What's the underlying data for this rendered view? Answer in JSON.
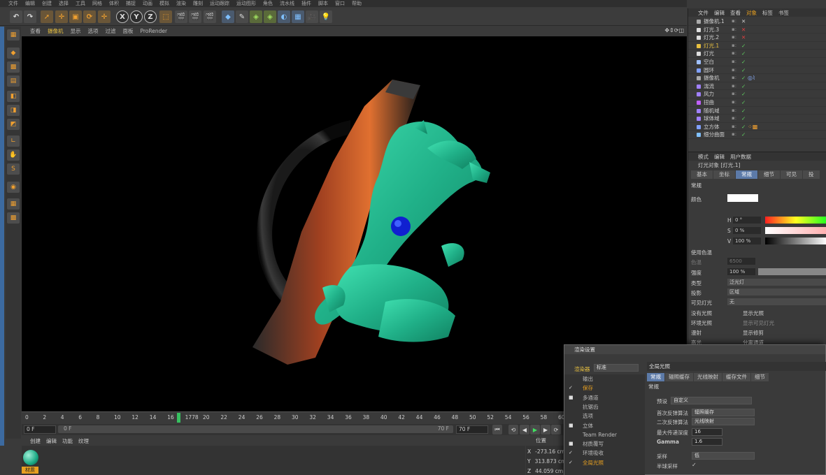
{
  "menubar": [
    "文件",
    "编辑",
    "创建",
    "选择",
    "工具",
    "网格",
    "体积",
    "捕捉",
    "动画",
    "模拟",
    "渲染",
    "雕刻",
    "运动跟踪",
    "运动图形",
    "角色",
    "流水线",
    "插件",
    "脚本",
    "窗口",
    "帮助"
  ],
  "toolbar": {
    "axis_x": "X",
    "axis_y": "Y",
    "axis_z": "Z"
  },
  "viewport_menu": [
    "查看",
    "摄像机",
    "显示",
    "选项",
    "过滤",
    "面板",
    "ProRender"
  ],
  "viewport_controls": "✥⇕⟳◫",
  "timeline": {
    "ticks": [
      "0",
      "2",
      "4",
      "6",
      "8",
      "10",
      "12",
      "14",
      "16",
      "1778",
      "20",
      "22",
      "24",
      "26",
      "28",
      "30",
      "32",
      "34",
      "36",
      "38",
      "40",
      "42",
      "44",
      "46",
      "48",
      "50",
      "52",
      "54",
      "56",
      "58",
      "60"
    ],
    "start_frame": "0 F",
    "slider_start": "0 F",
    "slider_end": "70 F",
    "end_frame": "70 F"
  },
  "material_panel": {
    "tabs": [
      "创建",
      "编辑",
      "功能",
      "纹理"
    ],
    "material_name": "材质"
  },
  "coords": {
    "header": "位置",
    "x_label": "X",
    "x_value": "-273.16 cm",
    "y_label": "Y",
    "y_value": "313.873 cm",
    "z_label": "Z",
    "z_value": "44.059 cm"
  },
  "object_manager": {
    "tabs": [
      "文件",
      "编辑",
      "查看",
      "对象",
      "标签",
      "书签"
    ],
    "active_tab": "对象",
    "objects": [
      {
        "name": "摄像机.1",
        "color": "#aaaaaa",
        "check": "✕",
        "check_color": "#cccccc"
      },
      {
        "name": "灯光.3",
        "color": "#dddddd",
        "check": "✕",
        "check_color": "#e04040"
      },
      {
        "name": "灯光.2",
        "color": "#dddddd",
        "check": "✕",
        "check_color": "#e04040"
      },
      {
        "name": "灯光.1",
        "color": "#e8c040",
        "check": "✓",
        "check_color": "#60d060"
      },
      {
        "name": "灯光",
        "color": "#dddddd",
        "check": "✓",
        "check_color": "#60d060"
      },
      {
        "name": "空白",
        "color": "#a0c0ff",
        "check": "✓",
        "check_color": "#60d060"
      },
      {
        "name": "圆环",
        "color": "#80a0ff",
        "check": "✓",
        "check_color": "#60d060"
      },
      {
        "name": "摄像机",
        "color": "#aaaaaa",
        "check": "✓",
        "check_color": "#60d060"
      },
      {
        "name": "湍流",
        "color": "#a080ff",
        "check": "✓",
        "check_color": "#60d060"
      },
      {
        "name": "风力",
        "color": "#a080ff",
        "check": "✓",
        "check_color": "#60d060"
      },
      {
        "name": "扭曲",
        "color": "#c060ff",
        "check": "✓",
        "check_color": "#60d060"
      },
      {
        "name": "随机域",
        "color": "#a080ff",
        "check": "✓",
        "check_color": "#60d060"
      },
      {
        "name": "球体域",
        "color": "#a080ff",
        "check": "✓",
        "check_color": "#60d060"
      },
      {
        "name": "立方体",
        "color": "#80a0ff",
        "check": "✓",
        "check_color": "#60d060"
      },
      {
        "name": "细分曲面",
        "color": "#80c0ff",
        "check": "✓",
        "check_color": "#60d060"
      }
    ]
  },
  "attributes": {
    "tabs": [
      "模式",
      "编辑",
      "用户数据"
    ],
    "title": "灯光对象 [灯光.1]",
    "panels": [
      "基本",
      "坐标",
      "常规",
      "细节",
      "可见",
      "投"
    ],
    "active_panel": "常规",
    "section": "常规",
    "color_label": "颜色",
    "h_label": "H",
    "h_value": "0 °",
    "s_label": "S",
    "s_value": "0 %",
    "v_label": "V",
    "v_value": "100 %",
    "use_temp": "使用色温",
    "temp_label": "色温",
    "temp_value": "6500",
    "intensity_label": "强度",
    "intensity_value": "100 %",
    "type_label": "类型",
    "type_value": "泛光灯",
    "shadow_label": "投影",
    "shadow_value": "区域",
    "visible_label": "可见灯光",
    "visible_value": "无",
    "no_illum": "没有光照",
    "show_illum": "显示光照",
    "ambient": "环境光照",
    "show_visible": "显示可见灯光",
    "diffuse": "漫射",
    "show_clip": "显示修剪",
    "specular": "高光",
    "sep_pass": "分离通道"
  },
  "render_dialog": {
    "title": "渲染设置",
    "renderer_label": "渲染器",
    "renderer_value": "标准",
    "items": [
      {
        "label": "输出",
        "check": ""
      },
      {
        "label": "保存",
        "check": "✓",
        "active": true
      },
      {
        "label": "多通道",
        "check": "■"
      },
      {
        "label": "抗锯齿",
        "check": ""
      },
      {
        "label": "选项",
        "check": ""
      },
      {
        "label": "立体",
        "check": "■"
      },
      {
        "label": "Team Render",
        "check": ""
      },
      {
        "label": "材质覆写",
        "check": "■"
      },
      {
        "label": "环境吸收",
        "check": "✓"
      },
      {
        "label": "全局光照",
        "check": "✓",
        "active": true
      }
    ],
    "panel_title": "全局光照",
    "tabs": [
      "常规",
      "辐照缓存",
      "光线映射",
      "缓存文件",
      "细节"
    ],
    "active_tab": "常规",
    "section": "常规",
    "preset_label": "预设",
    "preset_value": "自定义",
    "primary_label": "首次反弹算法",
    "primary_value": "辐照缓存",
    "secondary_label": "二次反弹算法",
    "secondary_value": "光线映射",
    "depth_label": "最大传递深度",
    "depth_value": "16",
    "gamma_label": "Gamma",
    "gamma_value": "1.6",
    "sample_label": "采样",
    "sample_value": "低",
    "half_label": "半球采样"
  }
}
